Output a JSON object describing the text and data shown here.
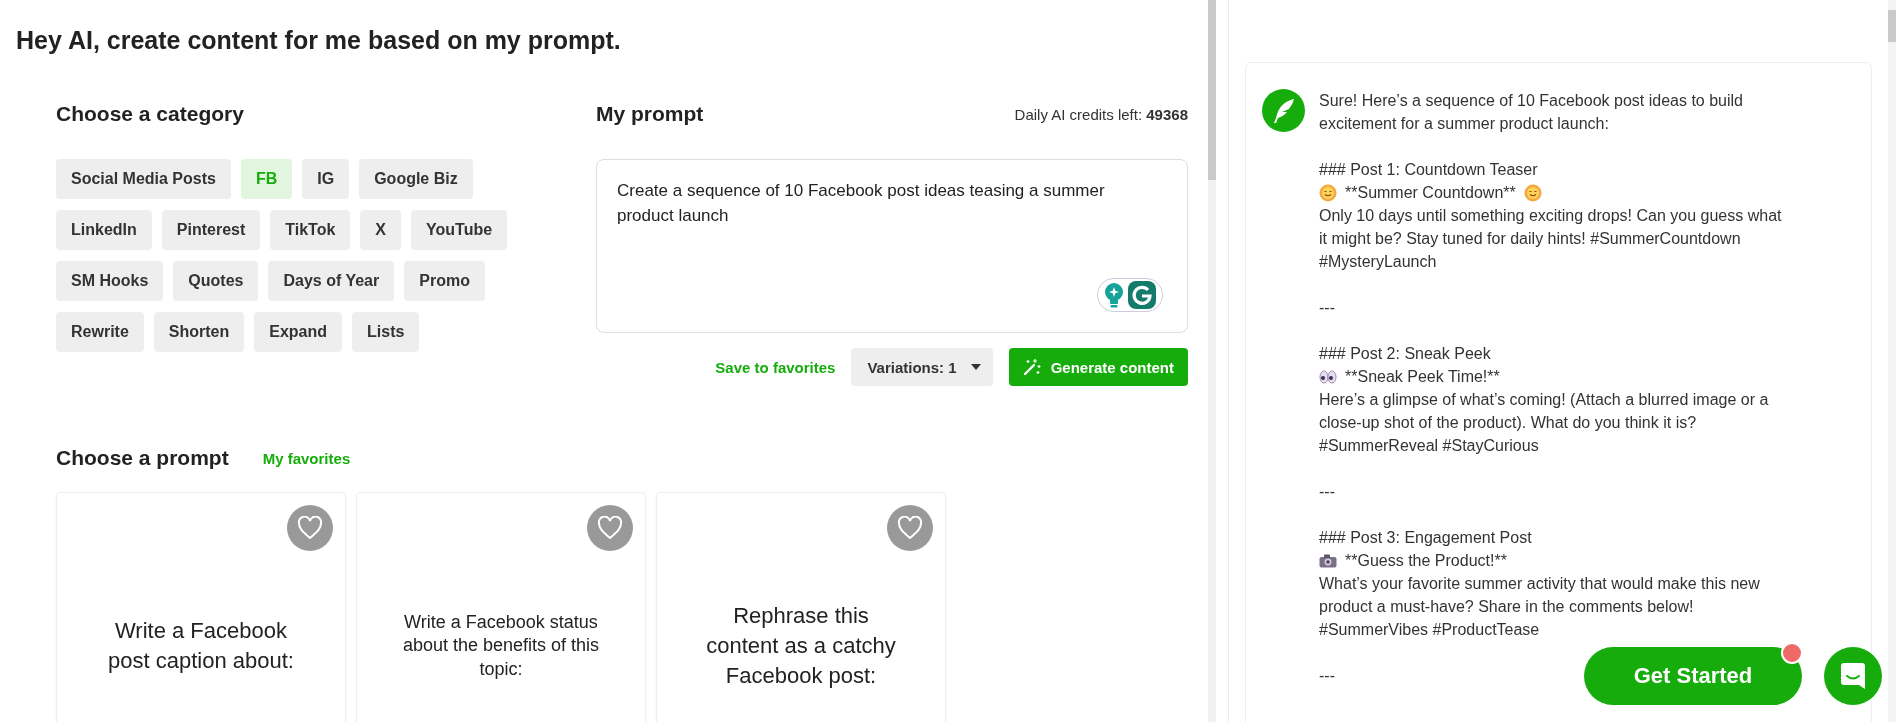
{
  "page_title": "Hey AI, create content for me based on my prompt.",
  "categories": {
    "heading": "Choose a category",
    "items": [
      {
        "label": "Social Media Posts",
        "selected": false
      },
      {
        "label": "FB",
        "selected": true
      },
      {
        "label": "IG",
        "selected": false
      },
      {
        "label": "Google Biz",
        "selected": false
      },
      {
        "label": "LinkedIn",
        "selected": false
      },
      {
        "label": "Pinterest",
        "selected": false
      },
      {
        "label": "TikTok",
        "selected": false
      },
      {
        "label": "X",
        "selected": false
      },
      {
        "label": "YouTube",
        "selected": false
      },
      {
        "label": "SM Hooks",
        "selected": false
      },
      {
        "label": "Quotes",
        "selected": false
      },
      {
        "label": "Days of Year",
        "selected": false
      },
      {
        "label": "Promo",
        "selected": false
      },
      {
        "label": "Rewrite",
        "selected": false
      },
      {
        "label": "Shorten",
        "selected": false
      },
      {
        "label": "Expand",
        "selected": false
      },
      {
        "label": "Lists",
        "selected": false
      }
    ]
  },
  "prompt": {
    "heading": "My prompt",
    "credits_label": "Daily AI credits left:",
    "credits_value": "49368",
    "value": "Create a sequence of 10 Facebook post ideas teasing a summer product launch",
    "save_link": "Save to favorites",
    "variations": "Variations: 1",
    "generate_button": "Generate content"
  },
  "prompt_library": {
    "heading": "Choose a prompt",
    "favorites_link": "My favorites",
    "cards": [
      {
        "text": "Write a Facebook post caption about:",
        "favorite": false
      },
      {
        "text": "Write a Facebook status about the benefits of this topic:",
        "favorite": false
      },
      {
        "text": "Rephrase this content as a catchy Facebook post:",
        "favorite": false
      }
    ]
  },
  "ai_content": {
    "blocks": [
      {
        "kind": "paragraph",
        "text": "Sure! Here’s a sequence of 10 Facebook post ideas to build excitement for a summer product launch:"
      },
      {
        "kind": "heading",
        "text": "### Post 1: Countdown Teaser"
      },
      {
        "kind": "sun-line",
        "text": "**Summer Countdown**"
      },
      {
        "kind": "paragraph",
        "text": "Only 10 days until something exciting drops! Can you guess what it might be? Stay tuned for daily hints! #SummerCountdown #MysteryLaunch"
      },
      {
        "kind": "divider",
        "text": "---"
      },
      {
        "kind": "heading",
        "text": "### Post 2: Sneak Peek"
      },
      {
        "kind": "eyes-line",
        "text": "**Sneak Peek Time!**"
      },
      {
        "kind": "paragraph",
        "text": "Here’s a glimpse of what’s coming! (Attach a blurred image or a close-up shot of the product). What do you think it is? #SummerReveal #StayCurious"
      },
      {
        "kind": "divider",
        "text": "---"
      },
      {
        "kind": "heading",
        "text": "### Post 3: Engagement Post"
      },
      {
        "kind": "camera-line",
        "text": "**Guess the Product!**"
      },
      {
        "kind": "paragraph",
        "text": "What’s your favorite summer activity that would make this new product a must-have? Share in the comments below! #SummerVibes #ProductTease"
      },
      {
        "kind": "divider",
        "text": "---"
      }
    ]
  },
  "get_started": {
    "label": "Get Started",
    "notification": true
  }
}
